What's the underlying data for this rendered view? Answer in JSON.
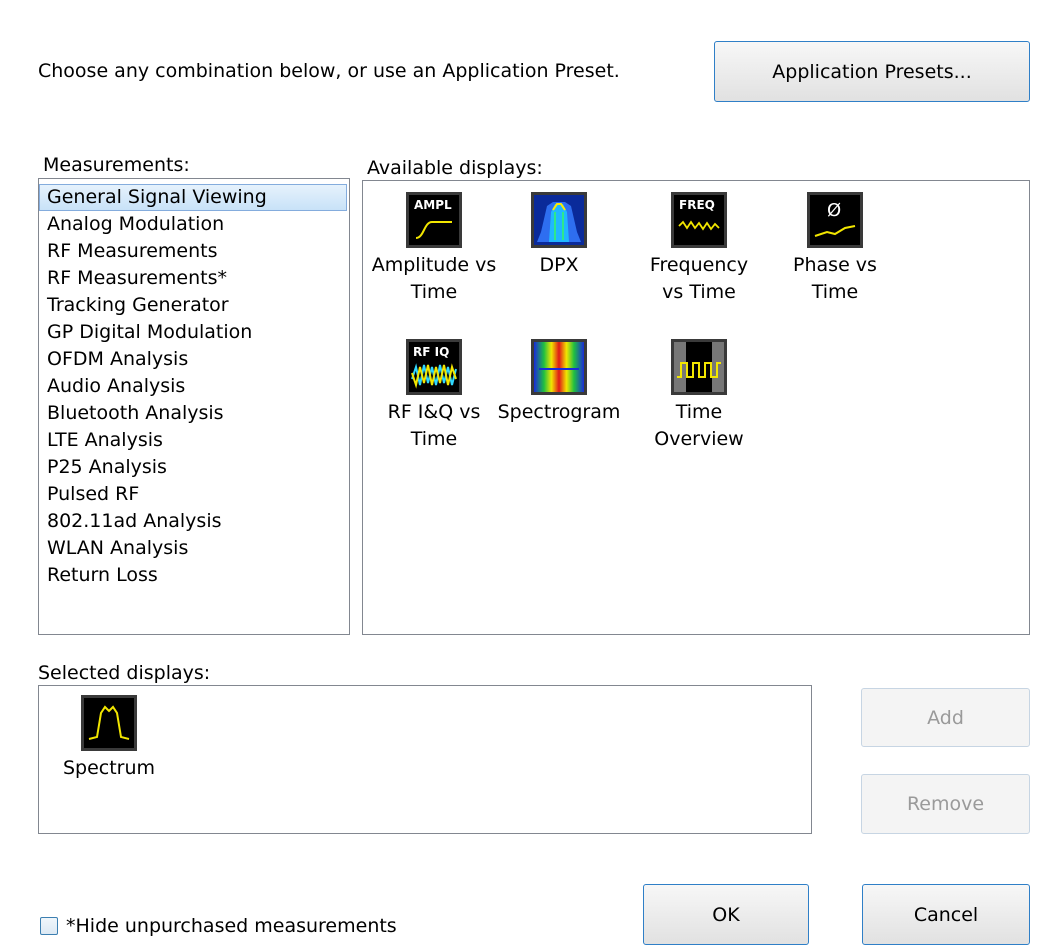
{
  "intro_text": "Choose any combination below, or use an Application Preset.",
  "presets_button_label": "Application Presets...",
  "measurements": {
    "label": "Measurements:",
    "selected": "General Signal Viewing",
    "items": [
      "General Signal Viewing",
      "Analog Modulation",
      "RF Measurements",
      "RF Measurements*",
      "Tracking Generator",
      "GP Digital Modulation",
      "OFDM Analysis",
      "Audio Analysis",
      "Bluetooth Analysis",
      "LTE Analysis",
      "P25 Analysis",
      "Pulsed RF",
      "802.11ad Analysis",
      "WLAN Analysis",
      "Return Loss"
    ]
  },
  "available": {
    "label": "Available displays:",
    "items": [
      {
        "icon": "amplitude-vs-time-icon",
        "icon_text": "AMPL",
        "line1": "Amplitude vs",
        "line2": "Time"
      },
      {
        "icon": "dpx-icon",
        "icon_text": "",
        "line1": "DPX",
        "line2": ""
      },
      {
        "icon": "frequency-vs-time-icon",
        "icon_text": "FREQ",
        "line1": "Frequency",
        "line2": "vs Time"
      },
      {
        "icon": "phase-vs-time-icon",
        "icon_text": "Ø",
        "line1": "Phase vs",
        "line2": "Time"
      },
      {
        "icon": "rf-iq-vs-time-icon",
        "icon_text": "RF IQ",
        "line1": "RF I&Q vs",
        "line2": "Time"
      },
      {
        "icon": "spectrogram-icon",
        "icon_text": "",
        "line1": "Spectrogram",
        "line2": ""
      },
      {
        "icon": "time-overview-icon",
        "icon_text": "",
        "line1": "Time",
        "line2": "Overview"
      }
    ]
  },
  "selected_displays": {
    "label": "Selected displays:",
    "items": [
      {
        "icon": "spectrum-icon",
        "line1": "Spectrum"
      }
    ]
  },
  "buttons": {
    "add": "Add",
    "remove": "Remove",
    "ok": "OK",
    "cancel": "Cancel"
  },
  "hide_unpurchased": {
    "label": "*Hide unpurchased measurements",
    "checked": false
  },
  "colors": {
    "accent_border": "#2f7fc7",
    "selection_fill": "#c8e2f8",
    "trace_yellow": "#f2e600"
  }
}
